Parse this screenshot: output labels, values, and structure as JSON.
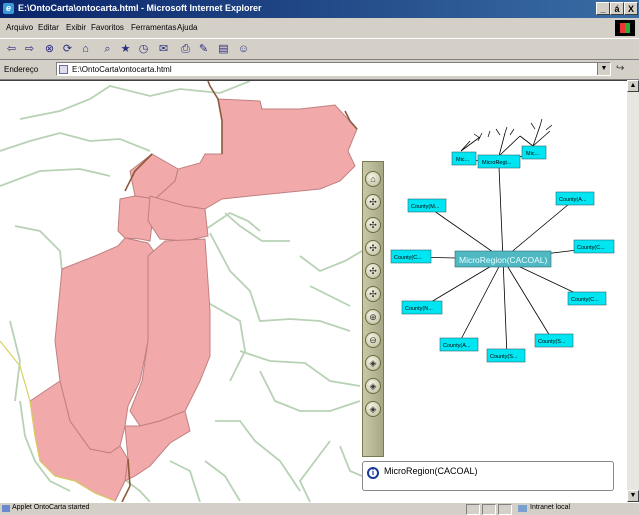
{
  "window": {
    "title": "E:\\OntoCarta\\ontocarta.html - Microsoft Internet Explorer",
    "controls": [
      "_",
      "á",
      "X"
    ]
  },
  "menu": {
    "items": [
      "Arquivo",
      "Editar",
      "Exibir",
      "Favoritos",
      "Ferramentas",
      "Ajuda"
    ]
  },
  "toolbar": {
    "icons": [
      "back-icon",
      "forward-icon",
      "stop-icon",
      "refresh-icon",
      "home-icon",
      "search-icon",
      "favorites-icon",
      "history-icon",
      "mail-icon",
      "print-icon",
      "edit-icon",
      "discuss-icon",
      "messenger-icon"
    ]
  },
  "address": {
    "label": "Endereço",
    "url": "E:\\OntoCarta\\ontocarta.html"
  },
  "graph": {
    "center": "MicroRegion(CACOAL)",
    "nodes": [
      "Mic...",
      "MicroRegi...",
      "Mic...",
      "County(M...",
      "County(A...",
      "County(C...",
      "County(C...",
      "County(C...",
      "County(N...",
      "County(S...",
      "County(A...",
      "County(S..."
    ]
  },
  "info": {
    "text": "MicroRegion(CACOAL)"
  },
  "status": {
    "text": "Applet OntoCarta started",
    "zone": "Intranet local"
  },
  "colors": {
    "region_fill": "#f2a9a9",
    "region_stroke": "#c08080",
    "boundary": "#b7d2b4",
    "node_fill": "#00e5f2",
    "center_fill": "#4fb8c2"
  }
}
